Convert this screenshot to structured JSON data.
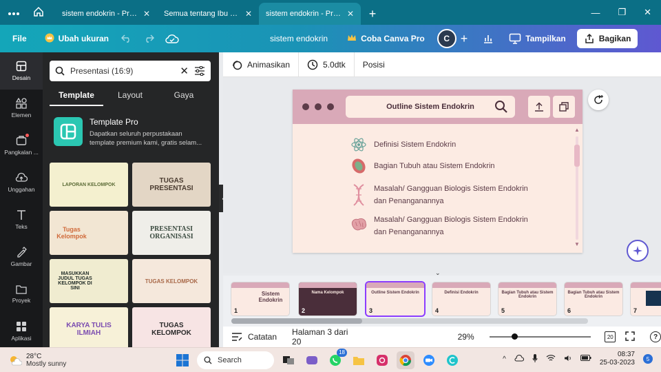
{
  "browser": {
    "tabs": [
      {
        "title": "sistem endokrin - Pres...",
        "active": false
      },
      {
        "title": "Semua tentang Ibu Gu...",
        "active": false
      },
      {
        "title": "sistem endokrin - Pres...",
        "active": true
      }
    ],
    "new_tab": "+",
    "win_min": "—",
    "win_max": "❐",
    "win_close": "✕"
  },
  "header": {
    "file": "File",
    "resize": "Ubah ukuran",
    "title": "sistem endokrin",
    "pro": "Coba Canva Pro",
    "avatar": "C",
    "present": "Tampilkan",
    "share": "Bagikan"
  },
  "rail": [
    {
      "label": "Desain",
      "icon": "layout-icon",
      "active": true
    },
    {
      "label": "Elemen",
      "icon": "shapes-icon",
      "active": false
    },
    {
      "label": "Pangkalan ...",
      "icon": "brand-kit-icon",
      "active": false
    },
    {
      "label": "Unggahan",
      "icon": "upload-icon",
      "active": false
    },
    {
      "label": "Teks",
      "icon": "text-icon",
      "active": false
    },
    {
      "label": "Gambar",
      "icon": "draw-icon",
      "active": false
    },
    {
      "label": "Proyek",
      "icon": "folder-icon",
      "active": false
    },
    {
      "label": "Aplikasi",
      "icon": "apps-icon",
      "active": false
    }
  ],
  "panel": {
    "search_value": "Presentasi (16:9)",
    "tabs": [
      "Template",
      "Layout",
      "Gaya"
    ],
    "pro_title": "Template Pro",
    "pro_desc": "Dapatkan seluruh perpustakaan template premium kami, gratis selam...",
    "templates": [
      {
        "text": "LAPORAN KELOMPOK",
        "bg": "#f4f0cf",
        "fg": "#5b6b36"
      },
      {
        "text": "TUGAS PRESENTASI",
        "bg": "#e3d6c5",
        "fg": "#4a3b30"
      },
      {
        "text": "Tugas Kelompok",
        "bg": "#f2e6d3",
        "fg": "#d06a3a"
      },
      {
        "text": "PRESENTASI ORGANISASI",
        "bg": "#efeee9",
        "fg": "#3a4a3f"
      },
      {
        "text": "MASUKKAN JUDUL TUGAS KELOMPOK DI SINI",
        "bg": "#f0ecd0",
        "fg": "#1f2a26"
      },
      {
        "text": "TUGAS KELOMPOK",
        "bg": "#f5e8dc",
        "fg": "#a86848"
      },
      {
        "text": "KARYA TULIS ILMIAH",
        "bg": "#f7f1d8",
        "fg": "#7a4bb0"
      },
      {
        "text": "TUGAS KELOMPOK",
        "bg": "#f7e4e4",
        "fg": "#2a2a2a"
      }
    ]
  },
  "toolbar": {
    "animate": "Animasikan",
    "duration": "5.0dtk",
    "position": "Posisi"
  },
  "slide": {
    "title": "Outline Sistem Endokrin",
    "bullets": [
      {
        "text": "Definisi Sistem Endokrin",
        "icon": "atom-icon"
      },
      {
        "text": "Bagian Tubuh atau Sistem Endokrin",
        "icon": "cell-icon"
      },
      {
        "text": "Masalah/ Gangguan Biologis Sistem Endokrin dan Penanganannya",
        "icon": "dna-icon"
      },
      {
        "text": "Masalah/ Gangguan Biologis Sistem Endokrin dan Penanganannya",
        "icon": "brain-icon"
      }
    ]
  },
  "pages": [
    {
      "num": "1",
      "title": "Sistem Endokrin",
      "active": false
    },
    {
      "num": "2",
      "title": "Nama Kelompok",
      "active": false
    },
    {
      "num": "3",
      "title": "Outline Sistem Endokrin",
      "active": true
    },
    {
      "num": "4",
      "title": "Definisi Endokrin",
      "active": false
    },
    {
      "num": "5",
      "title": "Bagian Tubuh atau Sistem Endokrin",
      "active": false
    },
    {
      "num": "6",
      "title": "Bagian Tubuh atau Sistem Endokrin",
      "active": false
    },
    {
      "num": "7",
      "title": "",
      "active": false
    }
  ],
  "bottombar": {
    "notes": "Catatan",
    "page_info": "Halaman 3 dari 20",
    "zoom": "29%",
    "zoom_fraction": 0.24,
    "grid_label": "20"
  },
  "taskbar": {
    "temp": "28°C",
    "weather": "Mostly sunny",
    "search": "Search",
    "whatsapp_badge": "18",
    "time": "08:37",
    "date": "25-03-2023",
    "notif_count": "5"
  },
  "colors": {
    "header_start": "#14a6b9",
    "header_end": "#5f58d1",
    "slide_bg": "#fcebe3",
    "slide_bar": "#d9a9b8",
    "accent": "#8b3dff"
  }
}
